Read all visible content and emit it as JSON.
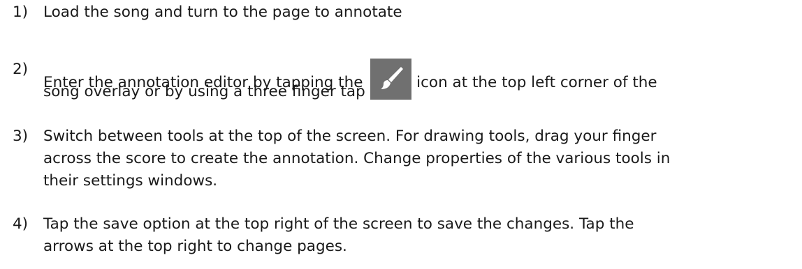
{
  "steps": [
    {
      "number": "1)",
      "lines": [
        "Load the song and turn to the page to annotate"
      ]
    },
    {
      "number": "2)",
      "line1_before_icon": "Enter the annotation editor by tapping the",
      "icon": "paintbrush-icon",
      "line1_after_icon": "icon at the top left corner of the",
      "line2": "song overlay or by using a three finger tap"
    },
    {
      "number": "3)",
      "lines": [
        "Switch between tools at the top of the screen. For drawing tools, drag your finger",
        "across the score to create the annotation. Change properties of the various tools in",
        "their settings windows."
      ]
    },
    {
      "number": "4)",
      "lines": [
        "Tap the save option at the top right of the screen to save the changes. Tap the",
        "arrows at the top right to change pages."
      ]
    }
  ],
  "colors": {
    "text": "#1a1a1a",
    "icon_background": "#707070",
    "icon_glyph": "#ffffff"
  }
}
